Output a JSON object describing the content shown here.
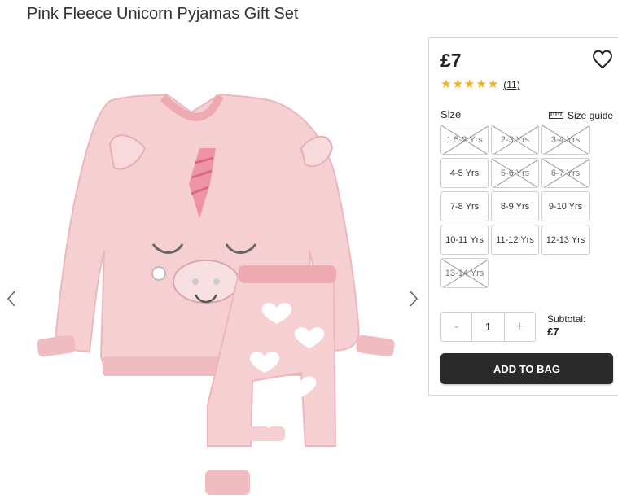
{
  "product": {
    "title": "Pink Fleece Unicorn Pyjamas Gift Set",
    "price": "£7",
    "rating": 5,
    "review_count": "(11)"
  },
  "sizes": {
    "label": "Size",
    "guide_label": "Size guide",
    "options": [
      {
        "label": "1.5-2 Yrs",
        "available": false
      },
      {
        "label": "2-3 Yrs",
        "available": false
      },
      {
        "label": "3-4 Yrs",
        "available": false
      },
      {
        "label": "4-5 Yrs",
        "available": true
      },
      {
        "label": "5-6 Yrs",
        "available": false
      },
      {
        "label": "6-7 Yrs",
        "available": false
      },
      {
        "label": "7-8 Yrs",
        "available": true
      },
      {
        "label": "8-9 Yrs",
        "available": true
      },
      {
        "label": "9-10 Yrs",
        "available": true
      },
      {
        "label": "10-11 Yrs",
        "available": true
      },
      {
        "label": "11-12 Yrs",
        "available": true
      },
      {
        "label": "12-13 Yrs",
        "available": true
      },
      {
        "label": "13-14 Yrs",
        "available": false
      }
    ]
  },
  "quantity": {
    "minus": "-",
    "value": "1",
    "plus": "+"
  },
  "subtotal": {
    "label": "Subtotal:",
    "value": "£7"
  },
  "add_to_bag": "ADD TO BAG",
  "colors": {
    "pink": "#f6cfd2",
    "pink_dark": "#eeb3b8",
    "button_dark": "#2a2a2a",
    "star": "#f2b01e"
  }
}
